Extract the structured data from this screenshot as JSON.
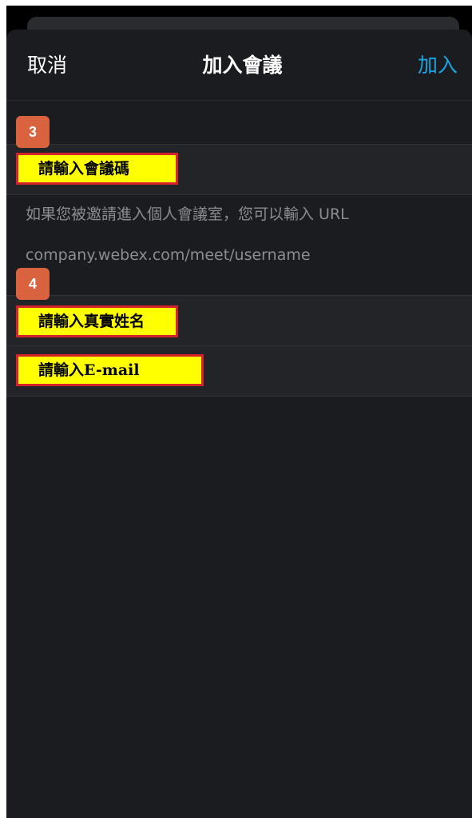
{
  "header": {
    "cancel_label": "取消",
    "title": "加入會議",
    "join_label": "加入"
  },
  "form": {
    "meeting_code_placeholder": "請輸入會議碼",
    "hint_line1": "如果您被邀請進入個人會議室，您可以輸入 URL",
    "hint_line2": "company.webex.com/meet/username",
    "name_placeholder": "請輸入真實姓名",
    "email_placeholder": "請輸入E-mail"
  },
  "annotations": {
    "step3": "3",
    "step4": "4"
  },
  "colors": {
    "accent": "#1aa6e4",
    "background": "#1b1c1f",
    "callout_fill": "#ffff00",
    "callout_border": "#d6232a",
    "step_badge": "#d9623f"
  }
}
